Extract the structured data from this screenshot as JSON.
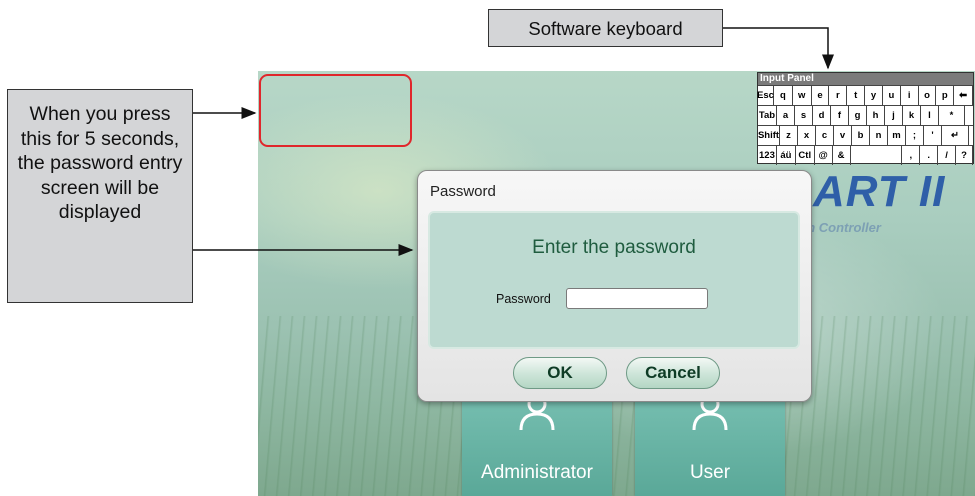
{
  "callouts": {
    "hold_text": "When you press this for 5 seconds, the password entry screen will be displayed",
    "keyboard_text": "Software keyboard"
  },
  "logo": {
    "text": "ART II",
    "subtitle": "ch Controller"
  },
  "keyboard": {
    "title": "Input Panel",
    "rows": [
      [
        "Esc",
        "q",
        "w",
        "e",
        "r",
        "t",
        "y",
        "u",
        "i",
        "o",
        "p",
        "⬅"
      ],
      [
        "Tab",
        "a",
        "s",
        "d",
        "f",
        "g",
        "h",
        "j",
        "k",
        "l",
        "*"
      ],
      [
        "Shift",
        "z",
        "x",
        "c",
        "v",
        "b",
        "n",
        "m",
        ";",
        "'",
        "↵"
      ],
      [
        "123",
        "áü",
        "Ctl",
        "@",
        "&",
        "",
        ",",
        ".",
        "/",
        "?"
      ]
    ]
  },
  "dialog": {
    "title": "Password",
    "heading": "Enter the password",
    "password_label": "Password",
    "password_value": "",
    "ok_label": "OK",
    "cancel_label": "Cancel"
  },
  "tiles": {
    "administrator_label": "Administrator",
    "user_label": "User"
  },
  "colors": {
    "hotspot_border": "#e0262b",
    "logo": "#2f5fa8",
    "tile": "#5aa898",
    "heading": "#1f5c3f"
  }
}
